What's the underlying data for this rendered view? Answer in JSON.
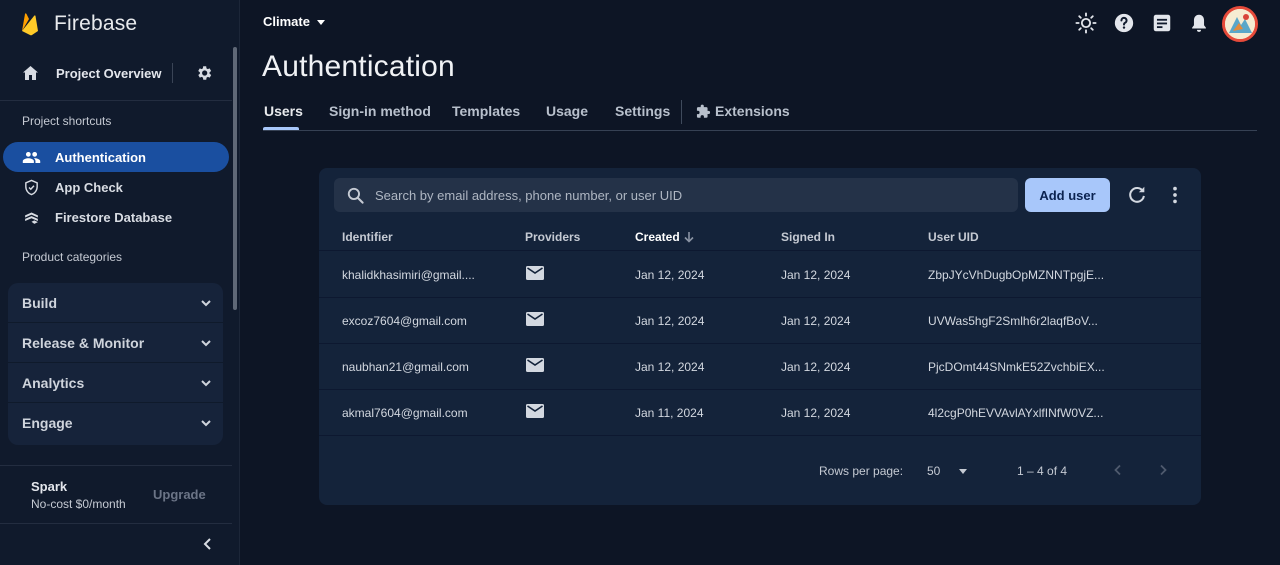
{
  "app": {
    "name": "Firebase"
  },
  "sidebar": {
    "project_overview": "Project Overview",
    "shortcuts_label": "Project shortcuts",
    "shortcuts": [
      {
        "label": "Authentication",
        "icon": "people-icon"
      },
      {
        "label": "App Check",
        "icon": "shield-icon"
      },
      {
        "label": "Firestore Database",
        "icon": "firestore-icon"
      }
    ],
    "categories_label": "Product categories",
    "categories": [
      {
        "label": "Build"
      },
      {
        "label": "Release & Monitor"
      },
      {
        "label": "Analytics"
      },
      {
        "label": "Engage"
      }
    ],
    "plan": {
      "name": "Spark",
      "description": "No-cost $0/month",
      "upgrade_label": "Upgrade"
    }
  },
  "topbar": {
    "project_name": "Climate"
  },
  "page": {
    "title": "Authentication",
    "tabs": [
      {
        "label": "Users"
      },
      {
        "label": "Sign-in method"
      },
      {
        "label": "Templates"
      },
      {
        "label": "Usage"
      },
      {
        "label": "Settings"
      },
      {
        "label": "Extensions"
      }
    ]
  },
  "users": {
    "search_placeholder": "Search by email address, phone number, or user UID",
    "add_user_label": "Add user",
    "columns": [
      "Identifier",
      "Providers",
      "Created",
      "Signed In",
      "User UID"
    ],
    "rows": [
      {
        "identifier": "khalidkhasimiri@gmail....",
        "provider": "mail-icon",
        "created": "Jan 12, 2024",
        "signed_in": "Jan 12, 2024",
        "uid": "ZbpJYcVhDugbOpMZNNTpgjE..."
      },
      {
        "identifier": "excoz7604@gmail.com",
        "provider": "mail-icon",
        "created": "Jan 12, 2024",
        "signed_in": "Jan 12, 2024",
        "uid": "UVWas5hgF2Smlh6r2laqfBoV..."
      },
      {
        "identifier": "naubhan21@gmail.com",
        "provider": "mail-icon",
        "created": "Jan 12, 2024",
        "signed_in": "Jan 12, 2024",
        "uid": "PjcDOmt44SNmkE52ZvchbiEX..."
      },
      {
        "identifier": "akmal7604@gmail.com",
        "provider": "mail-icon",
        "created": "Jan 11, 2024",
        "signed_in": "Jan 12, 2024",
        "uid": "4l2cgP0hEVVAvlAYxlfINfW0VZ..."
      }
    ],
    "footer": {
      "rows_per_page_label": "Rows per page:",
      "rows_per_page_value": "50",
      "range": "1 – 4 of 4"
    }
  },
  "colors": {
    "accent": "#a8c7fa",
    "active_nav": "#1a4fa0",
    "background": "#0d1525",
    "card": "#14233a"
  }
}
